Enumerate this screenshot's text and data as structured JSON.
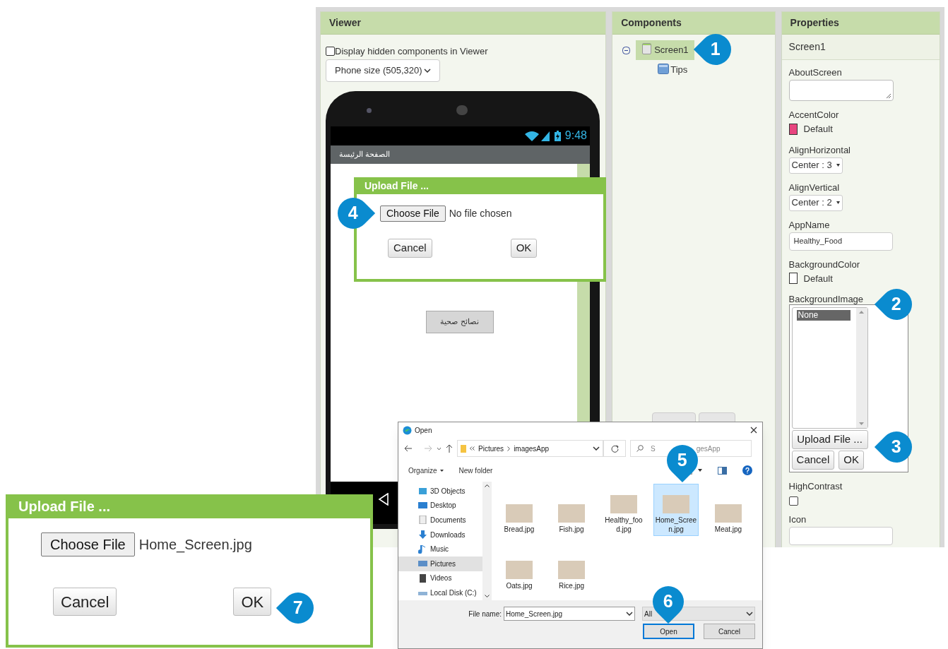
{
  "viewer": {
    "title": "Viewer",
    "hidden_checkbox": {
      "label": "Display hidden components in Viewer",
      "checked": false
    },
    "phone_size": "Phone size (505,320)",
    "phone": {
      "time": "9:48",
      "screen_title": "الصفحة الرئيسة",
      "button": "نصائح صحية"
    }
  },
  "components": {
    "title": "Components",
    "tree": [
      {
        "name": "Screen1",
        "selected": true,
        "expanded": true,
        "children": [
          {
            "name": "Tips",
            "selected": false
          }
        ]
      }
    ]
  },
  "properties": {
    "title": "Properties",
    "component": "Screen1",
    "items": [
      {
        "kind": "textarea",
        "label": "AboutScreen"
      },
      {
        "kind": "color",
        "label": "AccentColor",
        "value": "Default",
        "color": "#e8457f"
      },
      {
        "kind": "dropdown",
        "label": "AlignHorizontal",
        "value": "Center : 3"
      },
      {
        "kind": "dropdown",
        "label": "AlignVertical",
        "value": "Center : 2"
      },
      {
        "kind": "text",
        "label": "AppName",
        "value": "Healthy_Food"
      },
      {
        "kind": "color",
        "label": "BackgroundColor",
        "value": "Default",
        "color": "#ffffff"
      },
      {
        "kind": "asset",
        "label": "BackgroundImage",
        "options": [
          {
            "label": "None",
            "selected": true
          }
        ],
        "upload": "Upload File ...",
        "buttons": [
          "Cancel",
          "OK"
        ]
      },
      {
        "kind": "checkbox",
        "label": "HighContrast",
        "checked": false
      },
      {
        "kind": "text",
        "label": "Icon"
      }
    ]
  },
  "phone_upload_dialog": {
    "title": "Upload File ...",
    "choose": "Choose File",
    "file_status": "No file chosen",
    "buttons": [
      "Cancel",
      "OK"
    ]
  },
  "open_dialog": {
    "title": "Open",
    "path": [
      "Pictures",
      "imagesApp"
    ],
    "search": [
      "S",
      "gesApp"
    ],
    "toolbar": [
      "Organize",
      "New folder"
    ],
    "places": [
      {
        "label": "3D Objects",
        "selected": false
      },
      {
        "label": "Desktop",
        "selected": false
      },
      {
        "label": "Documents",
        "selected": false
      },
      {
        "label": "Downloads",
        "selected": false
      },
      {
        "label": "Music",
        "selected": false
      },
      {
        "label": "Pictures",
        "selected": true
      },
      {
        "label": "Videos",
        "selected": false
      },
      {
        "label": "Local Disk (C:)",
        "selected": false
      }
    ],
    "files": [
      {
        "name": "Bread.jpg",
        "selected": false
      },
      {
        "name": "Fish.jpg",
        "selected": false
      },
      {
        "name": "Healthy_food.jpg",
        "selected": false
      },
      {
        "name": "Home_Screen.jpg",
        "selected": true
      },
      {
        "name": "Meat.jpg",
        "selected": false
      },
      {
        "name": "Oats.jpg",
        "selected": false
      },
      {
        "name": "Rice.jpg",
        "selected": false
      }
    ],
    "file_name_label": "File name:",
    "file_name": "Home_Screen.jpg",
    "file_type": "All",
    "buttons": [
      "Open",
      "Cancel"
    ]
  },
  "zoomed_upload_dialog": {
    "title": "Upload File ...",
    "choose": "Choose File",
    "file_status": "Home_Screen.jpg",
    "buttons": [
      "Cancel",
      "OK"
    ]
  },
  "callouts": [
    "1",
    "2",
    "3",
    "4",
    "5",
    "6",
    "7"
  ]
}
